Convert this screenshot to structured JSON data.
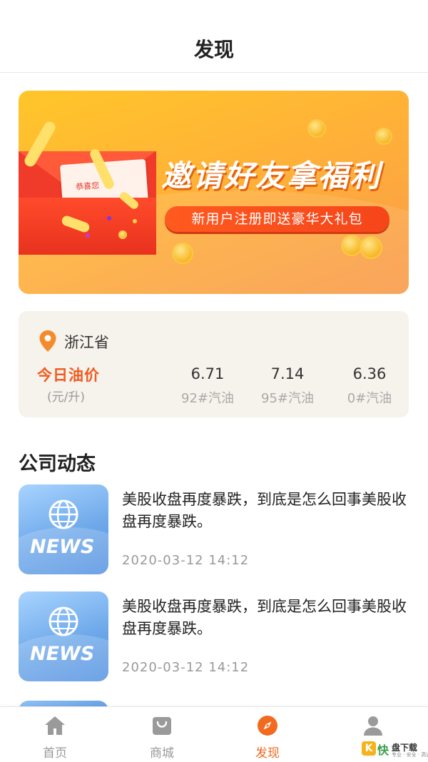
{
  "header": {
    "title": "发现"
  },
  "banner": {
    "title": "邀请好友拿福利",
    "subtitle": "新用户注册即送豪华大礼包",
    "card_label": "恭喜您"
  },
  "oil": {
    "province": "浙江省",
    "title": "今日油价",
    "unit": "(元/升)",
    "prices": [
      {
        "value": "6.71",
        "label": "92#汽油"
      },
      {
        "value": "7.14",
        "label": "95#汽油"
      },
      {
        "value": "6.36",
        "label": "0#汽油"
      }
    ]
  },
  "news_section": {
    "title": "公司动态",
    "thumb_label": "NEWS",
    "items": [
      {
        "text": "美股收盘再度暴跌，到底是怎么回事美股收盘再度暴跌。",
        "time": "2020-03-12  14:12"
      },
      {
        "text": "美股收盘再度暴跌，到底是怎么回事美股收盘再度暴跌。",
        "time": "2020-03-12  14:12"
      }
    ]
  },
  "tabbar": {
    "items": [
      {
        "label": "首页",
        "icon": "home-icon"
      },
      {
        "label": "商城",
        "icon": "shopping-bag-icon"
      },
      {
        "label": "发现",
        "icon": "compass-icon",
        "active": true
      },
      {
        "label": "我的",
        "icon": "user-icon"
      }
    ],
    "active_color": "#f26a1f",
    "inactive_color": "#999999"
  },
  "watermark": {
    "badge": "K",
    "fast": "快",
    "name": "盘下载",
    "sub": "专业 · 安全 · 高速"
  }
}
